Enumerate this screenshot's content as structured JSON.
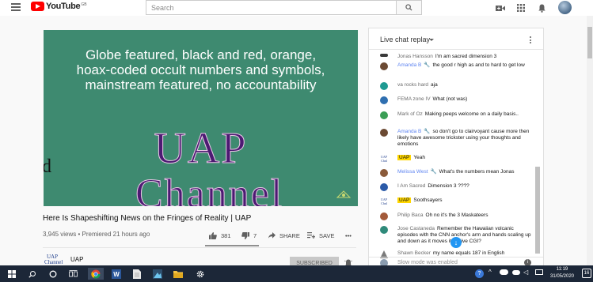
{
  "header": {
    "logo_text": "YouTube",
    "logo_region": "GB",
    "search_placeholder": "Search"
  },
  "video": {
    "caption_lines": [
      "Globe featured, black and red, orange,",
      "hoax-coded occult numbers and symbols,",
      "mainstream featured, no accountability"
    ],
    "overlay_title": "UAP",
    "overlay_subtitle": "Channel",
    "title": "Here Is Shapeshifting News on the Fringes of Reality | UAP",
    "meta": "3,945 views • Premiered 21 hours ago",
    "likes": "381",
    "dislikes": "7",
    "share_label": "SHARE",
    "save_label": "SAVE",
    "more_label": "•••"
  },
  "channel": {
    "name": "UAP",
    "logo_text": "UAP Channel",
    "subscribe_label": "SUBSCRIBED"
  },
  "chat": {
    "title": "Live chat replay",
    "input_placeholder": "Slow mode was enabled",
    "messages": [
      {
        "author": "Jonas Hansson",
        "text": "I'm am sacred dimension 3",
        "moderator": false,
        "owner": false,
        "avatar_color": "#3a3a3a"
      },
      {
        "author": "Amanda B",
        "text": "the good r high as and to hard to get low",
        "moderator": true,
        "owner": false,
        "avatar_color": "#6b4a33"
      },
      {
        "author": "va rocks hard",
        "text": "aja",
        "moderator": false,
        "owner": false,
        "avatar_color": "#1e9a92"
      },
      {
        "author": "FEMA zone IV",
        "text": "What (not was)",
        "moderator": false,
        "owner": false,
        "avatar_color": "#2f6fb0"
      },
      {
        "author": "Mark of Oz",
        "text": "Making peeps welcome on a daily basis..",
        "moderator": false,
        "owner": false,
        "avatar_color": "#3a9e55"
      },
      {
        "author": "Amanda B",
        "text": "so don't go to clairvoyant cause more then likely have awesome trickster using your thoughts and emotions",
        "moderator": true,
        "owner": false,
        "avatar_color": "#6b4a33"
      },
      {
        "author": "UAP",
        "text": "Yeah",
        "moderator": false,
        "owner": true,
        "avatar_color": "#ffffff"
      },
      {
        "author": "Melissa West",
        "text": "What's the numbers mean Jonas",
        "moderator": true,
        "owner": false,
        "avatar_color": "#8a5a3a"
      },
      {
        "author": "I Am Sacred",
        "text": "Dimension 3 ????",
        "moderator": false,
        "owner": false,
        "avatar_color": "#2b5aa8"
      },
      {
        "author": "UAP",
        "text": "Soothsayers",
        "moderator": false,
        "owner": true,
        "avatar_color": "#ffffff"
      },
      {
        "author": "Philip Baca",
        "text": "Oh no it's the 3 Maskateers",
        "moderator": false,
        "owner": false,
        "avatar_color": "#a35a3a"
      },
      {
        "author": "Jose Castaneda",
        "text": "Remember the Hawaiian volcanic episodes with the CNN anchor's arm and hands scaling up and down as it moves it. Active CGI?",
        "moderator": false,
        "owner": false,
        "avatar_color": "#2f8a7a"
      },
      {
        "author": "Shawn Becker",
        "text": "my name equals 187 in English",
        "moderator": false,
        "owner": false,
        "avatar_color": "#7a7a7a"
      }
    ]
  },
  "taskbar": {
    "time": "11:19",
    "date": "31/05/2020",
    "notifications": "16"
  }
}
